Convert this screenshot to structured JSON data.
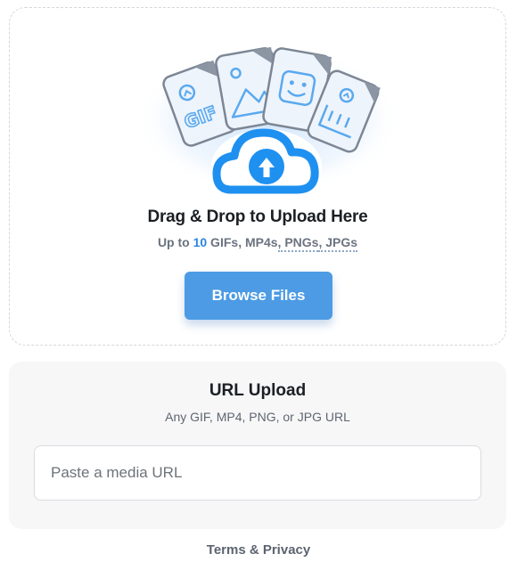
{
  "dropzone": {
    "title": "Drag & Drop to Upload Here",
    "subtitle": {
      "prefix": "Up to ",
      "count": "10",
      "formats": [
        " GIFs",
        ", MP4s",
        ", PNGs",
        ", JPGs"
      ]
    },
    "browse_label": "Browse Files",
    "illustration": {
      "gif_label": "GIF",
      "icons": [
        "gif-file-icon",
        "image-file-icon",
        "emoji-file-icon",
        "video-file-icon",
        "upload-cloud-icon"
      ]
    }
  },
  "url_upload": {
    "title": "URL Upload",
    "subtitle": "Any GIF, MP4, PNG, or JPG URL",
    "input_placeholder": "Paste a media URL",
    "input_value": ""
  },
  "footer": {
    "link_label": "Terms & Privacy"
  },
  "colors": {
    "accent": "#4c9be4",
    "count_highlight": "#2c86de",
    "panel_bg": "#f7f7f8",
    "cloud": "#2196f3"
  }
}
